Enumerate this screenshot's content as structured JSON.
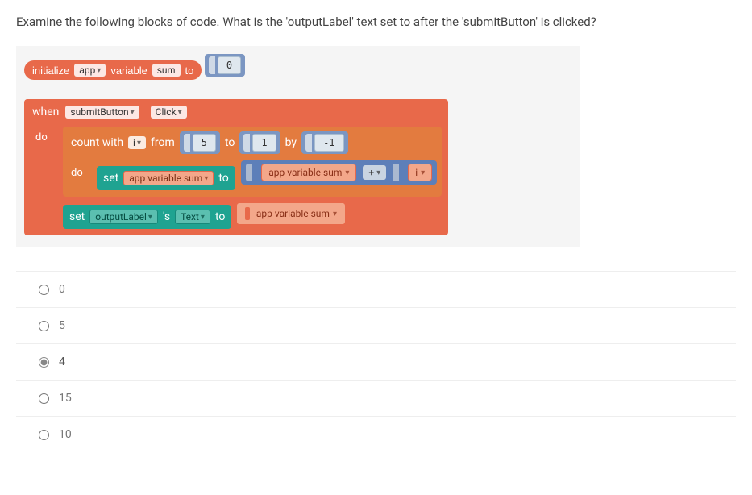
{
  "question": "Examine the following blocks of code. What is the 'outputLabel' text set to after the 'submitButton' is clicked?",
  "init": {
    "kw_initialize": "initialize",
    "scope": "app",
    "kw_variable": "variable",
    "varname": "sum",
    "kw_to": "to",
    "value": "0"
  },
  "when": {
    "kw_when": "when",
    "target": "submitButton",
    "event": "Click",
    "kw_do": "do"
  },
  "count": {
    "kw_count": "count with",
    "var": "i",
    "kw_from": "from",
    "from": "5",
    "kw_to": "to",
    "to": "1",
    "kw_by": "by",
    "by": "-1",
    "kw_do": "do"
  },
  "set_sum": {
    "kw_set": "set",
    "target": "app variable sum",
    "kw_to": "to"
  },
  "expr": {
    "left": "app variable sum",
    "op": "+",
    "right": "i"
  },
  "set_label": {
    "kw_set": "set",
    "target": "outputLabel",
    "poss": "'s",
    "prop": "Text",
    "kw_to": "to",
    "value": "app variable sum"
  },
  "options": [
    {
      "label": "0",
      "selected": false
    },
    {
      "label": "5",
      "selected": false
    },
    {
      "label": "4",
      "selected": true
    },
    {
      "label": "15",
      "selected": false
    },
    {
      "label": "10",
      "selected": false
    }
  ]
}
